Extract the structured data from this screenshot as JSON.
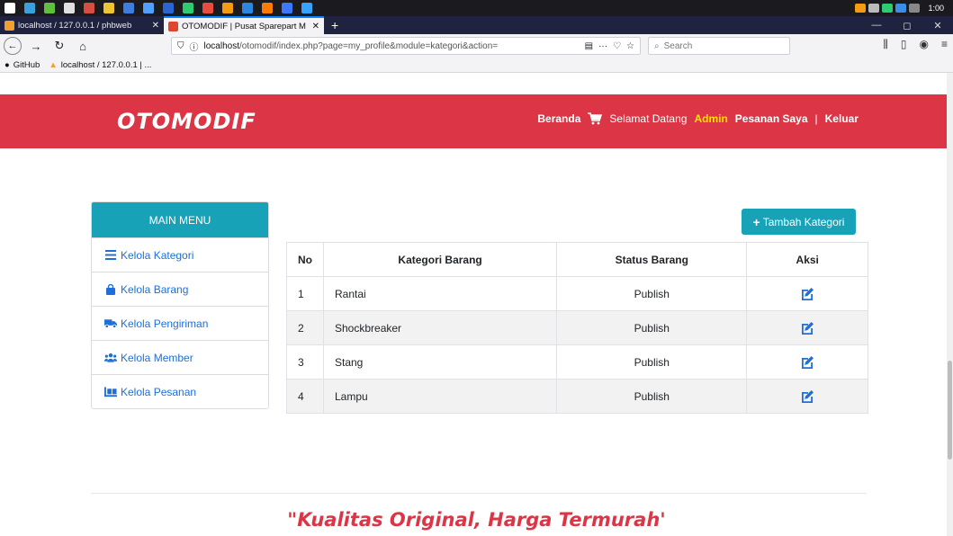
{
  "taskbar": {
    "clock": "1:00",
    "icon_colors": [
      "#ffffff",
      "#3aa1e0",
      "#5fbf3f",
      "#e0e0e0",
      "#d54e3f",
      "#f0c330",
      "#3c7de0",
      "#50a0ff",
      "#2a64d0",
      "#2ecc71",
      "#e84c3d",
      "#f39c12",
      "#2e86de",
      "#ff7a00",
      "#3a78ff",
      "#35a3ff"
    ]
  },
  "tabs": [
    {
      "label": "localhost / 127.0.0.1 / phbweb",
      "close": "✕"
    },
    {
      "label": "OTOMODIF | Pusat Sparepart M",
      "close": "✕"
    }
  ],
  "newtab": "+",
  "window": {
    "minimize": "—",
    "maximize": "◻",
    "close": "✕"
  },
  "nav": {
    "url_host": "localhost",
    "url_path": "/otomodif/index.php?page=my_profile&module=kategori&action=",
    "search_placeholder": "Search"
  },
  "bookmarks": [
    {
      "label": "GitHub"
    },
    {
      "label": "localhost / 127.0.0.1 | ..."
    }
  ],
  "header": {
    "brand": "OTOMODIF",
    "nav_home": "Beranda",
    "welcome": "Selamat Datang",
    "user": "Admin",
    "orders": "Pesanan Saya",
    "separator": "|",
    "logout": "Keluar"
  },
  "sidebar": {
    "title": "MAIN MENU",
    "items": [
      {
        "label": "Kelola Kategori",
        "icon": "list-icon"
      },
      {
        "label": "Kelola Barang",
        "icon": "shopping-bag-icon"
      },
      {
        "label": "Kelola Pengiriman",
        "icon": "truck-icon"
      },
      {
        "label": "Kelola Member",
        "icon": "users-icon"
      },
      {
        "label": "Kelola Pesanan",
        "icon": "dolly-icon"
      }
    ]
  },
  "content": {
    "add_button": "Tambah Kategori",
    "columns": {
      "no": "No",
      "kategori": "Kategori Barang",
      "status": "Status Barang",
      "aksi": "Aksi"
    },
    "rows": [
      {
        "no": "1",
        "kategori": "Rantai",
        "status": "Publish"
      },
      {
        "no": "2",
        "kategori": "Shockbreaker",
        "status": "Publish"
      },
      {
        "no": "3",
        "kategori": "Stang",
        "status": "Publish"
      },
      {
        "no": "4",
        "kategori": "Lampu",
        "status": "Publish"
      }
    ]
  },
  "footer": {
    "tagline": "\"Kualitas Original, Harga Termurah'"
  },
  "colors": {
    "brand_red": "#dc3545",
    "accent_teal": "#17a2b8",
    "link_blue": "#1e6fd9",
    "admin_yellow": "#ffe500"
  }
}
